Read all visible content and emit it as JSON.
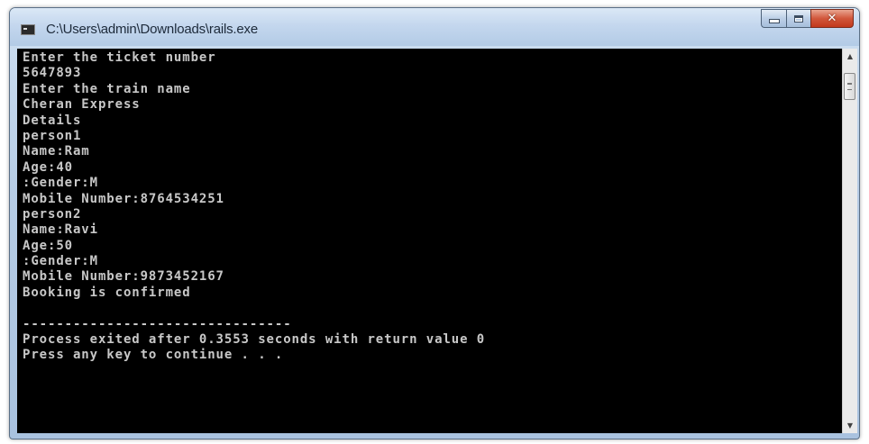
{
  "window": {
    "title": "C:\\Users\\admin\\Downloads\\rails.exe"
  },
  "console": {
    "lines": [
      "Enter the ticket number",
      "5647893",
      "Enter the train name",
      "Cheran Express",
      "Details",
      "person1",
      "Name:Ram",
      "Age:40",
      ":Gender:M",
      "Mobile Number:8764534251",
      "person2",
      "Name:Ravi",
      "Age:50",
      ":Gender:M",
      "Mobile Number:9873452167",
      "Booking is confirmed",
      "",
      "--------------------------------",
      "Process exited after 0.3553 seconds with return value 0",
      "Press any key to continue . . ."
    ]
  },
  "icons": {
    "app": "console-app-icon",
    "minimize": "minimize-icon",
    "maximize": "maximize-icon",
    "close": "close-icon",
    "scroll_up": "scroll-up-arrow-icon",
    "scroll_down": "scroll-down-arrow-icon"
  },
  "caption": {
    "close_glyph": "✕"
  },
  "colors": {
    "console_bg": "#000000",
    "console_text": "#c8c8c8",
    "close_button": "#c2381c"
  }
}
